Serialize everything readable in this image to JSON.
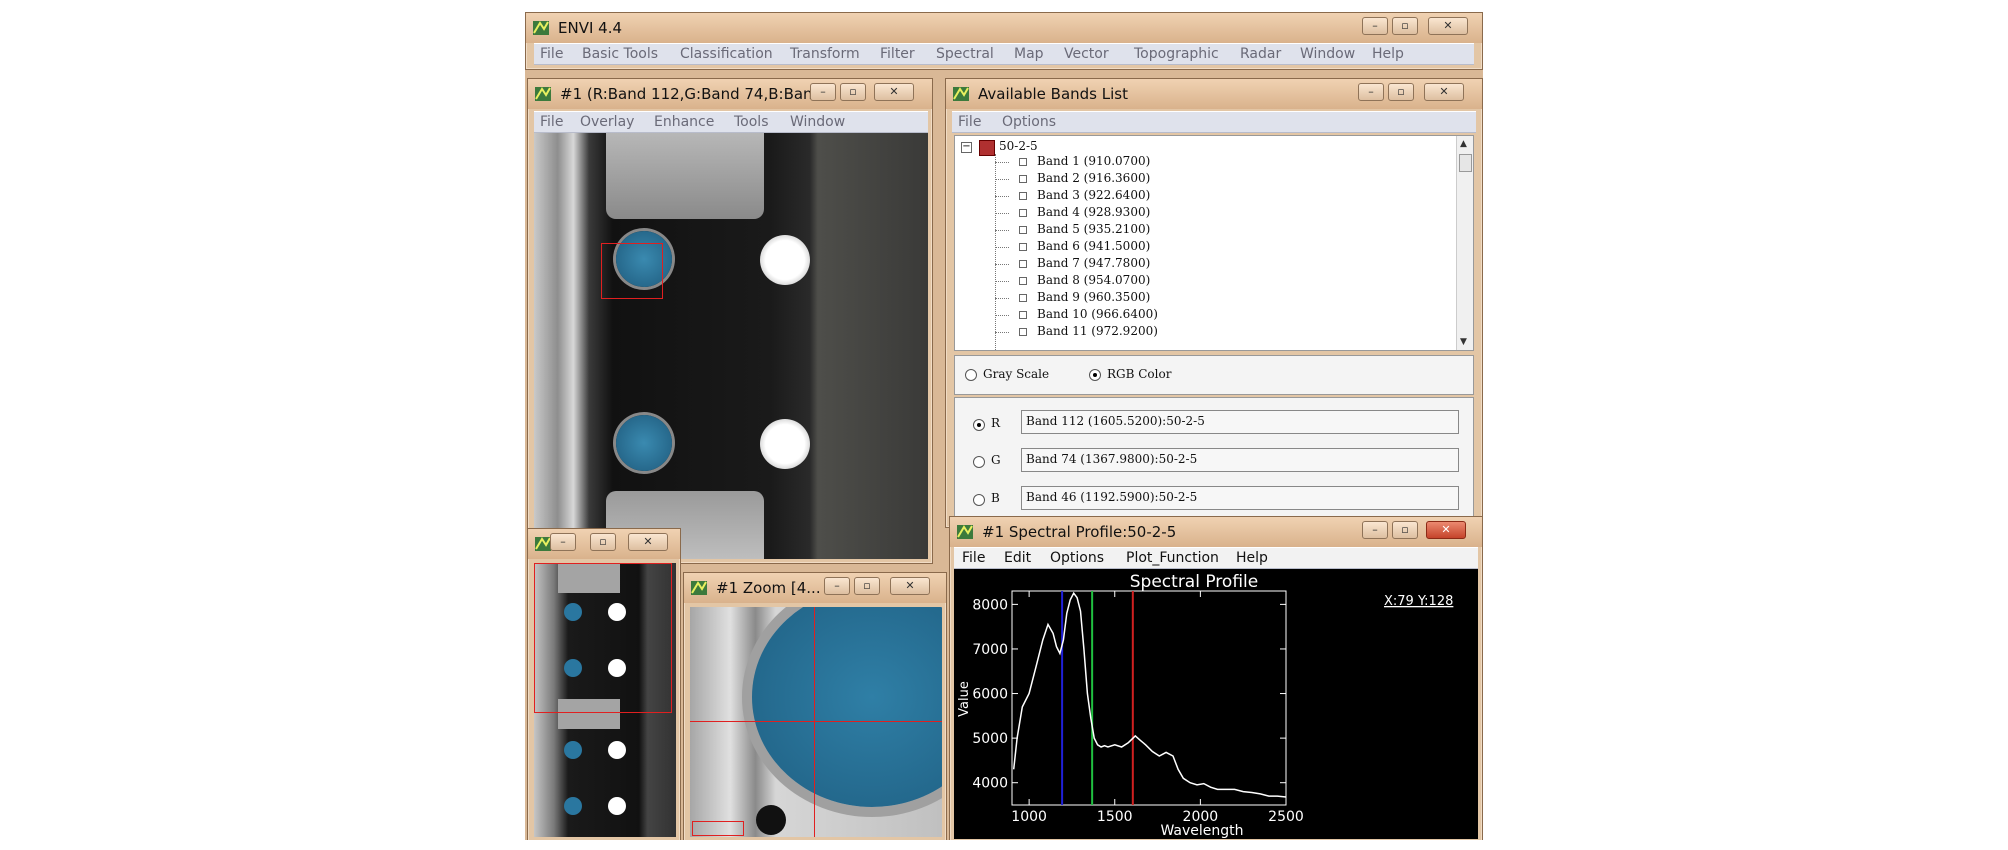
{
  "envi_window": {
    "title": "ENVI 4.4",
    "menu": [
      "File",
      "Basic Tools",
      "Classification",
      "Transform",
      "Filter",
      "Spectral",
      "Map",
      "Vector",
      "Topographic",
      "Radar",
      "Window",
      "Help"
    ]
  },
  "image_window": {
    "title": "#1 (R:Band 112,G:Band 74,B:Ban...",
    "menu": [
      "File",
      "Overlay",
      "Enhance",
      "Tools",
      "Window"
    ]
  },
  "bands_window": {
    "title": "Available Bands List",
    "menu": [
      "File",
      "Options"
    ],
    "tree_root": "50-2-5",
    "bands": [
      "Band 1  (910.0700)",
      "Band 2  (916.3600)",
      "Band 3  (922.6400)",
      "Band 4  (928.9300)",
      "Band 5  (935.2100)",
      "Band 6  (941.5000)",
      "Band 7  (947.7800)",
      "Band 8  (954.0700)",
      "Band 9  (960.3500)",
      "Band 10  (966.6400)",
      "Band 11  (972.9200)"
    ],
    "mode_gray": "Gray Scale",
    "mode_rgb": "RGB Color",
    "selected_mode": "RGB Color",
    "channels": [
      {
        "label": "R",
        "value": "Band 112  (1605.5200):50-2-5",
        "selected": true
      },
      {
        "label": "G",
        "value": "Band 74  (1367.9800):50-2-5",
        "selected": false
      },
      {
        "label": "B",
        "value": "Band 46  (1192.5900):50-2-5",
        "selected": false
      }
    ]
  },
  "zoom_window": {
    "title": "#1 Zoom [4..."
  },
  "profile_window": {
    "title": "#1 Spectral Profile:50-2-5",
    "menu": [
      "File",
      "Edit",
      "Options",
      "Plot_Function",
      "Help"
    ],
    "cursor_readout": "X:79 Y:128"
  },
  "chart_data": {
    "type": "line",
    "title": "Spectral Profile",
    "xlabel": "Wavelength",
    "ylabel": "Value",
    "xlim": [
      900,
      2500
    ],
    "ylim": [
      3500,
      8300
    ],
    "xticks": [
      1000,
      1500,
      2000,
      2500
    ],
    "yticks": [
      4000,
      5000,
      6000,
      7000,
      8000
    ],
    "series": [
      {
        "x": [
          910,
          930,
          960,
          1000,
          1040,
          1080,
          1110,
          1140,
          1160,
          1180,
          1200,
          1220,
          1240,
          1260,
          1280,
          1300,
          1320,
          1340,
          1360,
          1380,
          1400,
          1420,
          1440,
          1460,
          1500,
          1540,
          1580,
          1620,
          1650,
          1680,
          1720,
          1760,
          1800,
          1840,
          1870,
          1900,
          1940,
          1980,
          2020,
          2060,
          2100,
          2150,
          2200,
          2250,
          2300,
          2350,
          2400,
          2450,
          2500
        ],
        "y": [
          4300,
          5000,
          5700,
          6000,
          6600,
          7200,
          7550,
          7350,
          7050,
          6900,
          7200,
          7800,
          8100,
          8250,
          8150,
          7850,
          7000,
          6000,
          5450,
          5000,
          4850,
          4800,
          4830,
          4800,
          4850,
          4800,
          4900,
          5050,
          4950,
          4850,
          4700,
          4600,
          4680,
          4600,
          4300,
          4100,
          4000,
          3950,
          3980,
          3900,
          3850,
          3850,
          3850,
          3800,
          3780,
          3750,
          3700,
          3700,
          3680
        ],
        "color": "#ffffff"
      }
    ],
    "markers": [
      {
        "x": 1192.59,
        "color": "#2020d8"
      },
      {
        "x": 1367.98,
        "color": "#20c040"
      },
      {
        "x": 1605.52,
        "color": "#d02020"
      }
    ]
  }
}
